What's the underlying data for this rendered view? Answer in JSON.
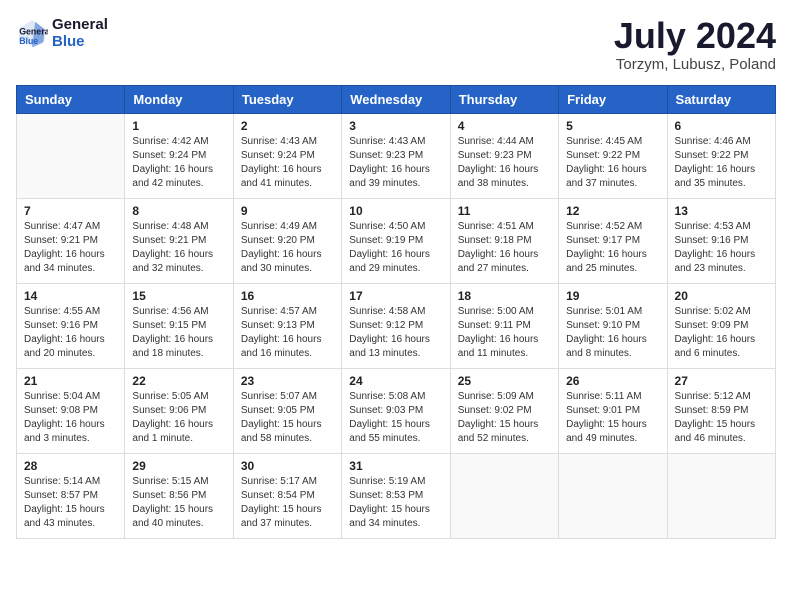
{
  "logo": {
    "line1": "General",
    "line2": "Blue"
  },
  "title": "July 2024",
  "location": "Torzym, Lubusz, Poland",
  "days_of_week": [
    "Sunday",
    "Monday",
    "Tuesday",
    "Wednesday",
    "Thursday",
    "Friday",
    "Saturday"
  ],
  "weeks": [
    [
      {
        "day": "",
        "content": ""
      },
      {
        "day": "1",
        "content": "Sunrise: 4:42 AM\nSunset: 9:24 PM\nDaylight: 16 hours\nand 42 minutes."
      },
      {
        "day": "2",
        "content": "Sunrise: 4:43 AM\nSunset: 9:24 PM\nDaylight: 16 hours\nand 41 minutes."
      },
      {
        "day": "3",
        "content": "Sunrise: 4:43 AM\nSunset: 9:23 PM\nDaylight: 16 hours\nand 39 minutes."
      },
      {
        "day": "4",
        "content": "Sunrise: 4:44 AM\nSunset: 9:23 PM\nDaylight: 16 hours\nand 38 minutes."
      },
      {
        "day": "5",
        "content": "Sunrise: 4:45 AM\nSunset: 9:22 PM\nDaylight: 16 hours\nand 37 minutes."
      },
      {
        "day": "6",
        "content": "Sunrise: 4:46 AM\nSunset: 9:22 PM\nDaylight: 16 hours\nand 35 minutes."
      }
    ],
    [
      {
        "day": "7",
        "content": "Sunrise: 4:47 AM\nSunset: 9:21 PM\nDaylight: 16 hours\nand 34 minutes."
      },
      {
        "day": "8",
        "content": "Sunrise: 4:48 AM\nSunset: 9:21 PM\nDaylight: 16 hours\nand 32 minutes."
      },
      {
        "day": "9",
        "content": "Sunrise: 4:49 AM\nSunset: 9:20 PM\nDaylight: 16 hours\nand 30 minutes."
      },
      {
        "day": "10",
        "content": "Sunrise: 4:50 AM\nSunset: 9:19 PM\nDaylight: 16 hours\nand 29 minutes."
      },
      {
        "day": "11",
        "content": "Sunrise: 4:51 AM\nSunset: 9:18 PM\nDaylight: 16 hours\nand 27 minutes."
      },
      {
        "day": "12",
        "content": "Sunrise: 4:52 AM\nSunset: 9:17 PM\nDaylight: 16 hours\nand 25 minutes."
      },
      {
        "day": "13",
        "content": "Sunrise: 4:53 AM\nSunset: 9:16 PM\nDaylight: 16 hours\nand 23 minutes."
      }
    ],
    [
      {
        "day": "14",
        "content": "Sunrise: 4:55 AM\nSunset: 9:16 PM\nDaylight: 16 hours\nand 20 minutes."
      },
      {
        "day": "15",
        "content": "Sunrise: 4:56 AM\nSunset: 9:15 PM\nDaylight: 16 hours\nand 18 minutes."
      },
      {
        "day": "16",
        "content": "Sunrise: 4:57 AM\nSunset: 9:13 PM\nDaylight: 16 hours\nand 16 minutes."
      },
      {
        "day": "17",
        "content": "Sunrise: 4:58 AM\nSunset: 9:12 PM\nDaylight: 16 hours\nand 13 minutes."
      },
      {
        "day": "18",
        "content": "Sunrise: 5:00 AM\nSunset: 9:11 PM\nDaylight: 16 hours\nand 11 minutes."
      },
      {
        "day": "19",
        "content": "Sunrise: 5:01 AM\nSunset: 9:10 PM\nDaylight: 16 hours\nand 8 minutes."
      },
      {
        "day": "20",
        "content": "Sunrise: 5:02 AM\nSunset: 9:09 PM\nDaylight: 16 hours\nand 6 minutes."
      }
    ],
    [
      {
        "day": "21",
        "content": "Sunrise: 5:04 AM\nSunset: 9:08 PM\nDaylight: 16 hours\nand 3 minutes."
      },
      {
        "day": "22",
        "content": "Sunrise: 5:05 AM\nSunset: 9:06 PM\nDaylight: 16 hours\nand 1 minute."
      },
      {
        "day": "23",
        "content": "Sunrise: 5:07 AM\nSunset: 9:05 PM\nDaylight: 15 hours\nand 58 minutes."
      },
      {
        "day": "24",
        "content": "Sunrise: 5:08 AM\nSunset: 9:03 PM\nDaylight: 15 hours\nand 55 minutes."
      },
      {
        "day": "25",
        "content": "Sunrise: 5:09 AM\nSunset: 9:02 PM\nDaylight: 15 hours\nand 52 minutes."
      },
      {
        "day": "26",
        "content": "Sunrise: 5:11 AM\nSunset: 9:01 PM\nDaylight: 15 hours\nand 49 minutes."
      },
      {
        "day": "27",
        "content": "Sunrise: 5:12 AM\nSunset: 8:59 PM\nDaylight: 15 hours\nand 46 minutes."
      }
    ],
    [
      {
        "day": "28",
        "content": "Sunrise: 5:14 AM\nSunset: 8:57 PM\nDaylight: 15 hours\nand 43 minutes."
      },
      {
        "day": "29",
        "content": "Sunrise: 5:15 AM\nSunset: 8:56 PM\nDaylight: 15 hours\nand 40 minutes."
      },
      {
        "day": "30",
        "content": "Sunrise: 5:17 AM\nSunset: 8:54 PM\nDaylight: 15 hours\nand 37 minutes."
      },
      {
        "day": "31",
        "content": "Sunrise: 5:19 AM\nSunset: 8:53 PM\nDaylight: 15 hours\nand 34 minutes."
      },
      {
        "day": "",
        "content": ""
      },
      {
        "day": "",
        "content": ""
      },
      {
        "day": "",
        "content": ""
      }
    ]
  ]
}
